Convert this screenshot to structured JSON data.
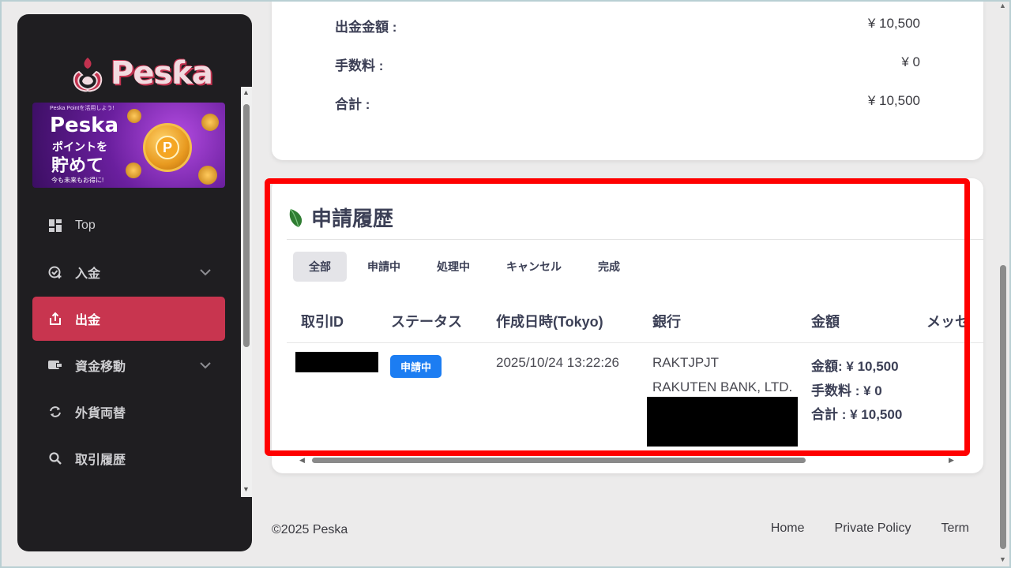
{
  "brand": {
    "name": "Pesƙa"
  },
  "promo": {
    "small": "Peska Pointを活用しよう!",
    "title": "Peska",
    "line1": "ポイントを",
    "line2": "貯めて",
    "foot": "今も未来もお得に!",
    "coin_letter": "P"
  },
  "nav": [
    {
      "label": "Top",
      "icon": "dashboard-icon"
    },
    {
      "label": "入金",
      "icon": "deposit-icon"
    },
    {
      "label": "出金",
      "icon": "withdraw-icon"
    },
    {
      "label": "資金移動",
      "icon": "transfer-icon"
    },
    {
      "label": "外貨両替",
      "icon": "exchange-icon"
    },
    {
      "label": "取引履歴",
      "icon": "search-icon"
    }
  ],
  "summary": [
    {
      "label": "出金金額 :",
      "value": "¥ 10,500"
    },
    {
      "label": "手数料 :",
      "value": "¥ 0"
    },
    {
      "label": "合計 :",
      "value": "¥ 10,500"
    }
  ],
  "history": {
    "title": "申請履歴",
    "tabs": [
      "全部",
      "申請中",
      "処理中",
      "キャンセル",
      "完成"
    ],
    "columns": [
      "取引ID",
      "ステータス",
      "作成日時(Tokyo)",
      "銀行",
      "金額",
      "メッセ"
    ],
    "row": {
      "status": "申請中",
      "created": "2025/10/24 13:22:26",
      "bank_code": "RAKTJPJT",
      "bank_name": "RAKUTEN BANK, LTD.",
      "amount_label": "金額: ",
      "amount_value": "¥ 10,500",
      "fee_label": "手数料 : ",
      "fee_value": "¥ 0",
      "total_label": "合計 : ",
      "total_value": "¥ 10,500"
    }
  },
  "footer": {
    "copyright": "©2025 Peska",
    "links": [
      "Home",
      "Private Policy",
      "Term"
    ]
  },
  "colors": {
    "accent": "#c8354f",
    "badge": "#1c7df2",
    "highlight": "#ff0000"
  }
}
